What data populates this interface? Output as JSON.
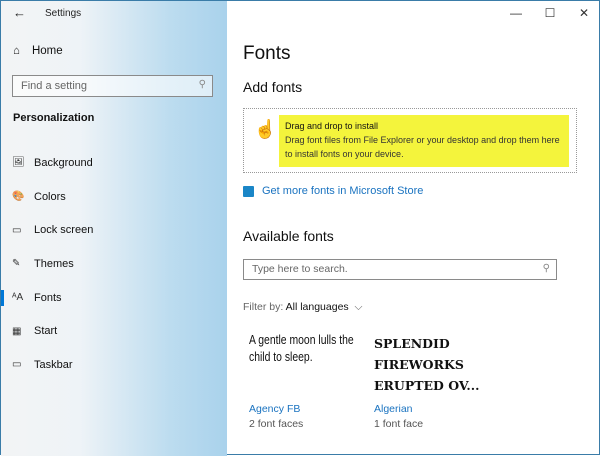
{
  "window": {
    "title": "Settings",
    "back": "←",
    "minimize": "—",
    "maximize": "☐",
    "close": "✕"
  },
  "sidebar": {
    "home": "Home",
    "search_placeholder": "Find a setting",
    "section": "Personalization",
    "items": [
      {
        "label": "Background",
        "icon": "🖼"
      },
      {
        "label": "Colors",
        "icon": "🎨"
      },
      {
        "label": "Lock screen",
        "icon": "▭"
      },
      {
        "label": "Themes",
        "icon": "✎"
      },
      {
        "label": "Fonts",
        "icon": "ᴬA"
      },
      {
        "label": "Start",
        "icon": "▦"
      },
      {
        "label": "Taskbar",
        "icon": "▭"
      }
    ],
    "selected": "Fonts"
  },
  "main": {
    "title": "Fonts",
    "add_heading": "Add fonts",
    "drop_title": "Drag and drop to install",
    "drop_desc": "Drag font files from File Explorer or your desktop and drop them here to install fonts on your device.",
    "store_link": "Get more fonts in Microsoft Store",
    "available_heading": "Available fonts",
    "search_placeholder": "Type here to search.",
    "filter_label": "Filter by:",
    "filter_value": "All languages",
    "fonts": [
      {
        "sample": "A gentle moon lulls the child to sleep.",
        "name": "Agency FB",
        "faces": "2 font faces"
      },
      {
        "sample": "SPLENDID FIREWORKS ERUPTED OV...",
        "name": "Algerian",
        "faces": "1 font face"
      }
    ]
  },
  "colors": {
    "accent": "#0078d7",
    "highlight": "#f4f43c",
    "link": "#1a73c0"
  }
}
